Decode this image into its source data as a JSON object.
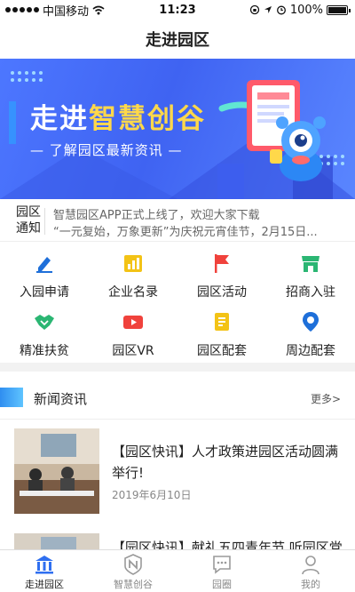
{
  "status_bar": {
    "carrier": "中国移动",
    "time": "11:23",
    "battery": "100%"
  },
  "header": {
    "title": "走进园区"
  },
  "banner": {
    "title_white": "走进",
    "title_yellow": "智慧创谷",
    "subtitle": "— 了解园区最新资讯 —"
  },
  "notice": {
    "tag_line1": "园区",
    "tag_line2": "通知",
    "items": [
      "智慧园区APP正式上线了，欢迎大家下载",
      "“一元复始，万象更新”为庆祝元宵佳节，2月15日..."
    ]
  },
  "quick_menu": {
    "items": [
      {
        "label": "入园申请",
        "icon": "pen-icon",
        "color": "#1e6fd9"
      },
      {
        "label": "企业名录",
        "icon": "bar-chart-icon",
        "color": "#f3c316"
      },
      {
        "label": "园区活动",
        "icon": "flag-icon",
        "color": "#f0423c"
      },
      {
        "label": "招商入驻",
        "icon": "store-icon",
        "color": "#2bb673"
      },
      {
        "label": "精准扶贫",
        "icon": "handshake-icon",
        "color": "#2bb673"
      },
      {
        "label": "园区VR",
        "icon": "video-camera-icon",
        "color": "#f0423c"
      },
      {
        "label": "园区配套",
        "icon": "document-icon",
        "color": "#f3c316"
      },
      {
        "label": "周边配套",
        "icon": "location-pin-icon",
        "color": "#1e6fd9"
      }
    ]
  },
  "news": {
    "title": "新闻资讯",
    "more": "更多>",
    "items": [
      {
        "title": "【园区快讯】人才政策进园区活动圆满举行!",
        "date": "2019年6月10日"
      },
      {
        "title": "【园区快讯】献礼五四青年节 听园区党",
        "date": ""
      }
    ]
  },
  "tab_bar": {
    "items": [
      {
        "label": "走进园区",
        "icon": "building-icon",
        "active": true
      },
      {
        "label": "智慧创谷",
        "icon": "shield-logo-icon",
        "active": false
      },
      {
        "label": "园圈",
        "icon": "chat-bubble-icon",
        "active": false
      },
      {
        "label": "我的",
        "icon": "user-icon",
        "active": false
      }
    ]
  },
  "colors": {
    "accent_blue": "#2f6ff0",
    "banner_blue": "#4068f5",
    "banner_yellow": "#ffd84a"
  }
}
